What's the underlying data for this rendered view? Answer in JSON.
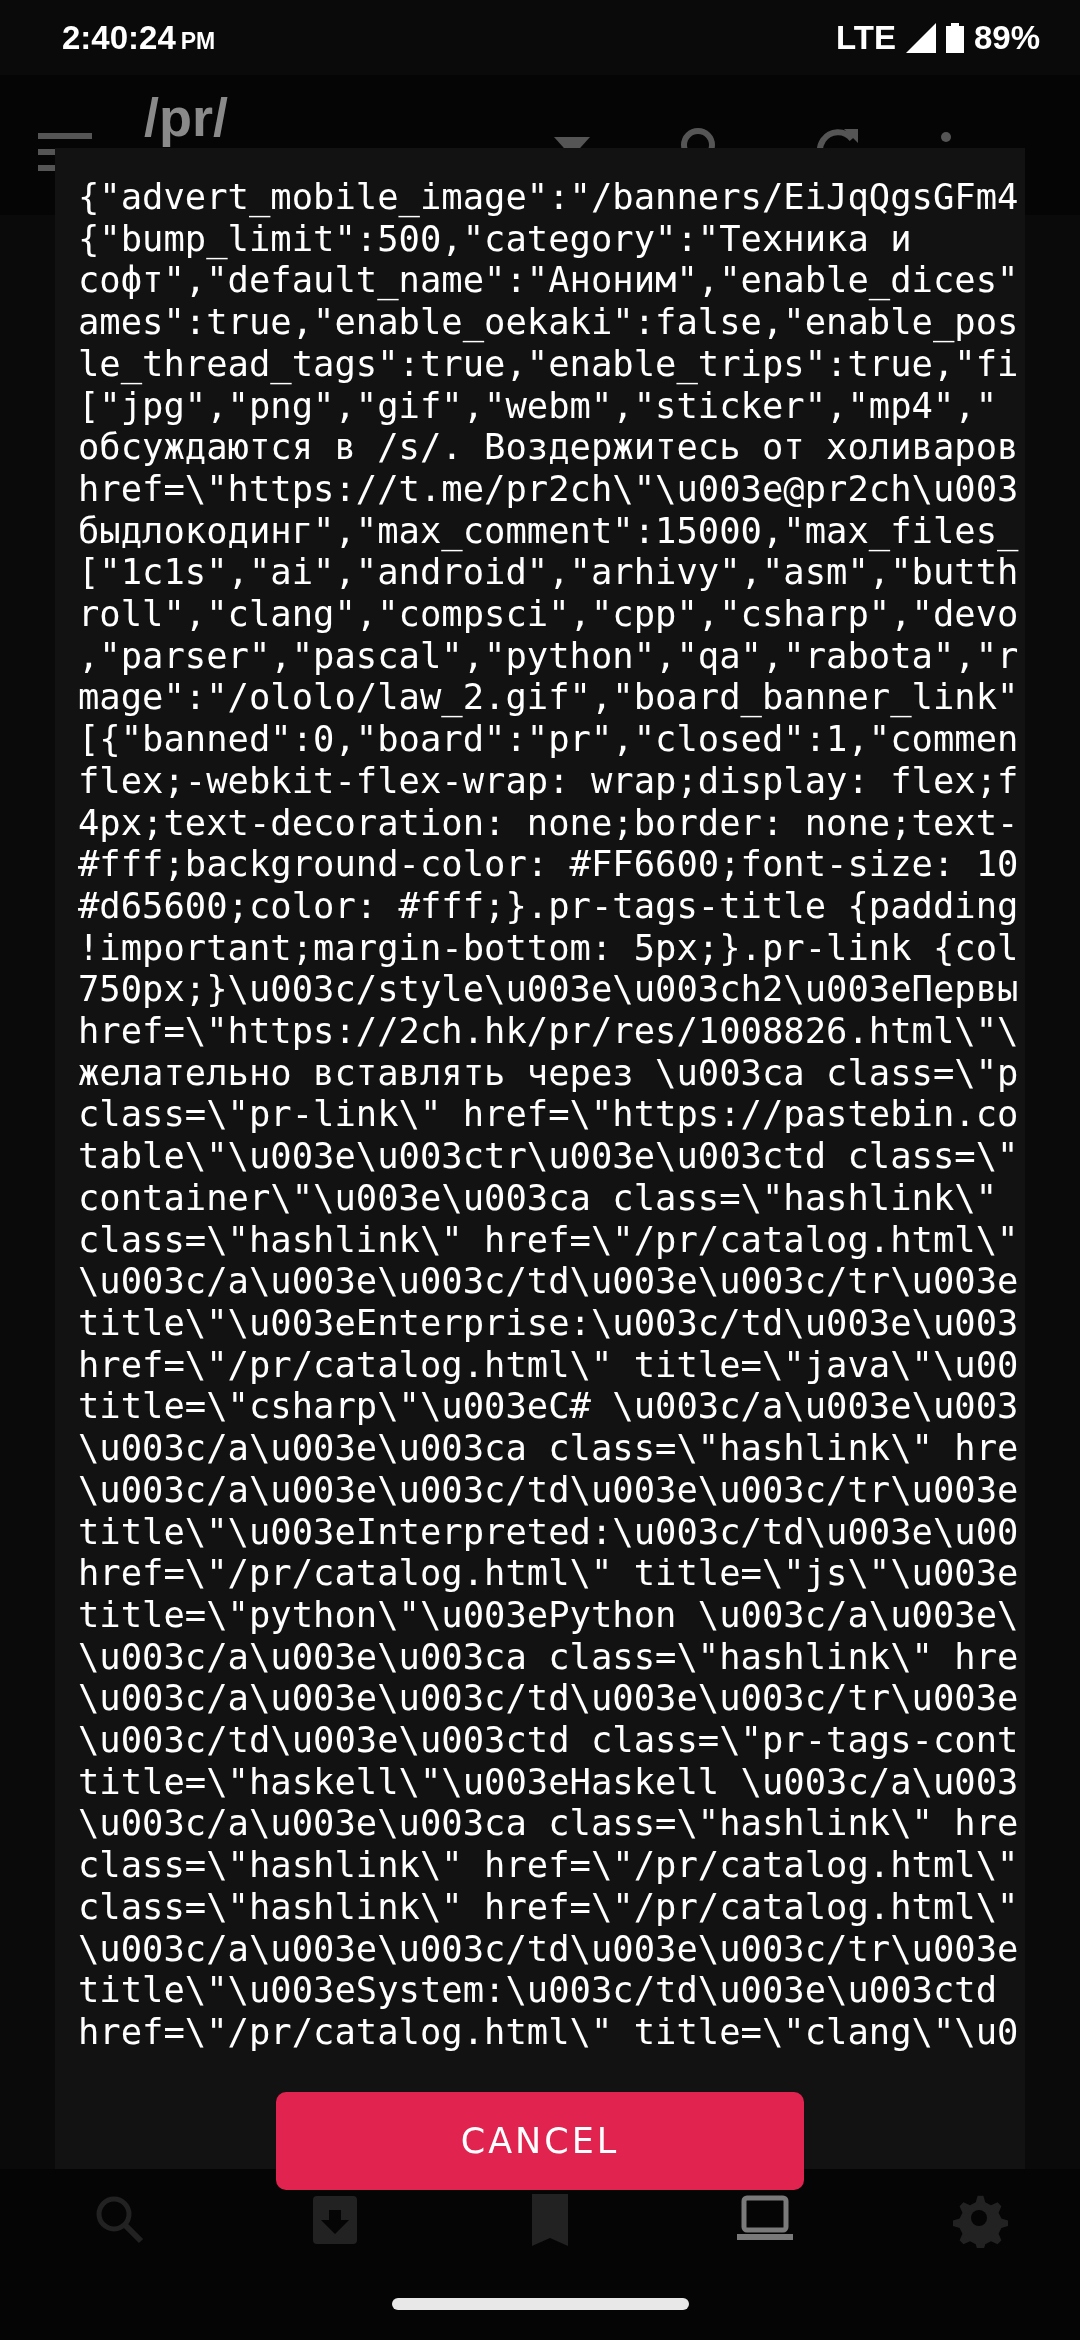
{
  "status_bar": {
    "time": "2:40:24",
    "ampm": "PM",
    "network": "LTE",
    "battery": "89%"
  },
  "app_bar": {
    "title": "/pr/"
  },
  "dialog": {
    "lines": [
      "{\"advert_mobile_image\":\"/banners/EiJqQgsGFm4",
      "{\"bump_limit\":500,\"category\":\"Техника и",
      "софт\",\"default_name\":\"Аноним\",\"enable_dices\"",
      "ames\":true,\"enable_oekaki\":false,\"enable_pos",
      "le_thread_tags\":true,\"enable_trips\":true,\"fi",
      "[\"jpg\",\"png\",\"gif\",\"webm\",\"sticker\",\"mp4\",\"",
      "обсуждаются в /s/. Воздержитесь от холиваров",
      "href=\\\"https://t.me/pr2ch\\\"\\u003e@pr2ch\\u003",
      "быдлокодинг\",\"max_comment\":15000,\"max_files_",
      "[\"1c1s\",\"ai\",\"android\",\"arhivy\",\"asm\",\"butth",
      "roll\",\"clang\",\"compsci\",\"cpp\",\"csharp\",\"devo",
      ",\"parser\",\"pascal\",\"python\",\"qa\",\"rabota\",\"r",
      "mage\":\"/ololo/law_2.gif\",\"board_banner_link\"",
      "[{\"banned\":0,\"board\":\"pr\",\"closed\":1,\"commen",
      "flex;-webkit-flex-wrap: wrap;display: flex;f",
      "4px;text-decoration: none;border: none;text-",
      "#fff;background-color: #FF6600;font-size: 10",
      "#d65600;color: #fff;}.pr-tags-title {padding",
      "!important;margin-bottom: 5px;}.pr-link {col",
      "750px;}\\u003c/style\\u003e\\u003ch2\\u003eПервы",
      "href=\\\"https://2ch.hk/pr/res/1008826.html\\\"\\",
      "желательно вставлять через \\u003ca class=\\\"p",
      "class=\\\"pr-link\\\" href=\\\"https://pastebin.co",
      "table\\\"\\u003e\\u003ctr\\u003e\\u003ctd class=\\\"",
      "container\\\"\\u003e\\u003ca class=\\\"hashlink\\\"",
      "class=\\\"hashlink\\\" href=\\\"/pr/catalog.html\\\"",
      "\\u003c/a\\u003e\\u003c/td\\u003e\\u003c/tr\\u003e",
      "title\\\"\\u003eEnterprise:\\u003c/td\\u003e\\u003",
      "href=\\\"/pr/catalog.html\\\" title=\\\"java\\\"\\u00",
      "title=\\\"csharp\\\"\\u003eC# \\u003c/a\\u003e\\u003",
      "\\u003c/a\\u003e\\u003ca class=\\\"hashlink\\\" hre",
      "\\u003c/a\\u003e\\u003c/td\\u003e\\u003c/tr\\u003e",
      "title\\\"\\u003eInterpreted:\\u003c/td\\u003e\\u00",
      "href=\\\"/pr/catalog.html\\\" title=\\\"js\\\"\\u003e",
      "title=\\\"python\\\"\\u003ePython \\u003c/a\\u003e\\",
      "\\u003c/a\\u003e\\u003ca class=\\\"hashlink\\\" hre",
      "\\u003c/a\\u003e\\u003c/td\\u003e\\u003c/tr\\u003e",
      "\\u003c/td\\u003e\\u003ctd class=\\\"pr-tags-cont",
      "title=\\\"haskell\\\"\\u003eHaskell \\u003c/a\\u003",
      "\\u003c/a\\u003e\\u003ca class=\\\"hashlink\\\" hre",
      "class=\\\"hashlink\\\" href=\\\"/pr/catalog.html\\\"",
      "class=\\\"hashlink\\\" href=\\\"/pr/catalog.html\\\"",
      "\\u003c/a\\u003e\\u003c/td\\u003e\\u003c/tr\\u003e",
      "title\\\"\\u003eSystem:\\u003c/td\\u003e\\u003ctd",
      "href=\\\"/pr/catalog.html\\\" title=\\\"clang\\\"\\u0"
    ],
    "button": "CANCEL"
  },
  "bottom_nav": [
    {
      "selected": false
    },
    {
      "selected": false
    },
    {
      "selected": false
    },
    {
      "selected": true
    },
    {
      "selected": false
    }
  ]
}
